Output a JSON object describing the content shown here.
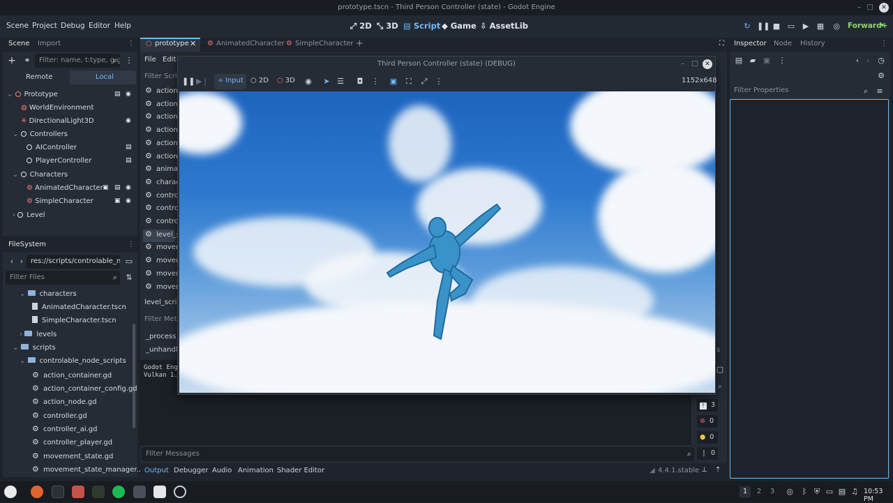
{
  "window_title": "prototype.tscn - Third Person Controller (state) - Godot Engine",
  "menu": [
    "Scene",
    "Project",
    "Debug",
    "Editor",
    "Help"
  ],
  "workspaces": [
    "2D",
    "3D",
    "Script",
    "Game",
    "AssetLib"
  ],
  "renderer": "Forward+",
  "scene_panel": {
    "tabs": [
      "Scene",
      "Import"
    ],
    "filter_placeholder": "Filter: name, t:type, g:gr",
    "remote": "Remote",
    "local": "Local",
    "tree": [
      "Prototype",
      "WorldEnvironment",
      "DirectionalLight3D",
      "Controllers",
      "AIController",
      "PlayerController",
      "Characters",
      "AnimatedCharacter",
      "SimpleCharacter",
      "Level"
    ]
  },
  "filesystem": {
    "title": "FileSystem",
    "path": "res://scripts/controlable_nod",
    "filter_placeholder": "Filter Files",
    "items": [
      "characters",
      "AnimatedCharacter.tscn",
      "SimpleCharacter.tscn",
      "levels",
      "scripts",
      "controlable_node_scripts",
      "action_container.gd",
      "action_container_config.gd",
      "action_node.gd",
      "controller.gd",
      "controller_ai.gd",
      "controller_player.gd",
      "movement_state.gd",
      "movement_state_manager..."
    ]
  },
  "editor_tabs": [
    "prototype",
    "AnimatedCharacter",
    "SimpleCharacter"
  ],
  "script_menu": [
    "File",
    "Edit"
  ],
  "script_filter": "Filter Scrip",
  "script_list": [
    "action_",
    "action_",
    "action_",
    "action_",
    "action_",
    "action_",
    "animat",
    "charac",
    "contro",
    "contro",
    "contro",
    "level_s",
    "movem",
    "movem",
    "movem",
    "movem"
  ],
  "current_script": "level_scrip",
  "methods_filter": "Filter Meth",
  "methods": [
    "_process",
    "_unhandle"
  ],
  "output_log": [
    "Godot Eng",
    "Vulkan 1."
  ],
  "debug_window": {
    "title": "Third Person Controller (state) (DEBUG)",
    "input_label": "Input",
    "mode_2d": "2D",
    "mode_3d": "3D",
    "resolution": "1152x648"
  },
  "counters": [
    "3",
    "0",
    "0",
    "0"
  ],
  "filter_messages": "Filter Messages",
  "bottom_tabs": [
    "Output",
    "Debugger",
    "Audio",
    "Animation",
    "Shader Editor"
  ],
  "version": "4.4.1.stable",
  "inspector": {
    "tabs": [
      "Inspector",
      "Node",
      "History"
    ],
    "filter_placeholder": "Filter Properties"
  },
  "taskbar": {
    "workspaces": [
      "1",
      "2",
      "3"
    ],
    "clock": "10:53 PM"
  },
  "colors": {
    "accent": "#70bafa",
    "background": "#1e232b",
    "panel": "#262c35"
  }
}
